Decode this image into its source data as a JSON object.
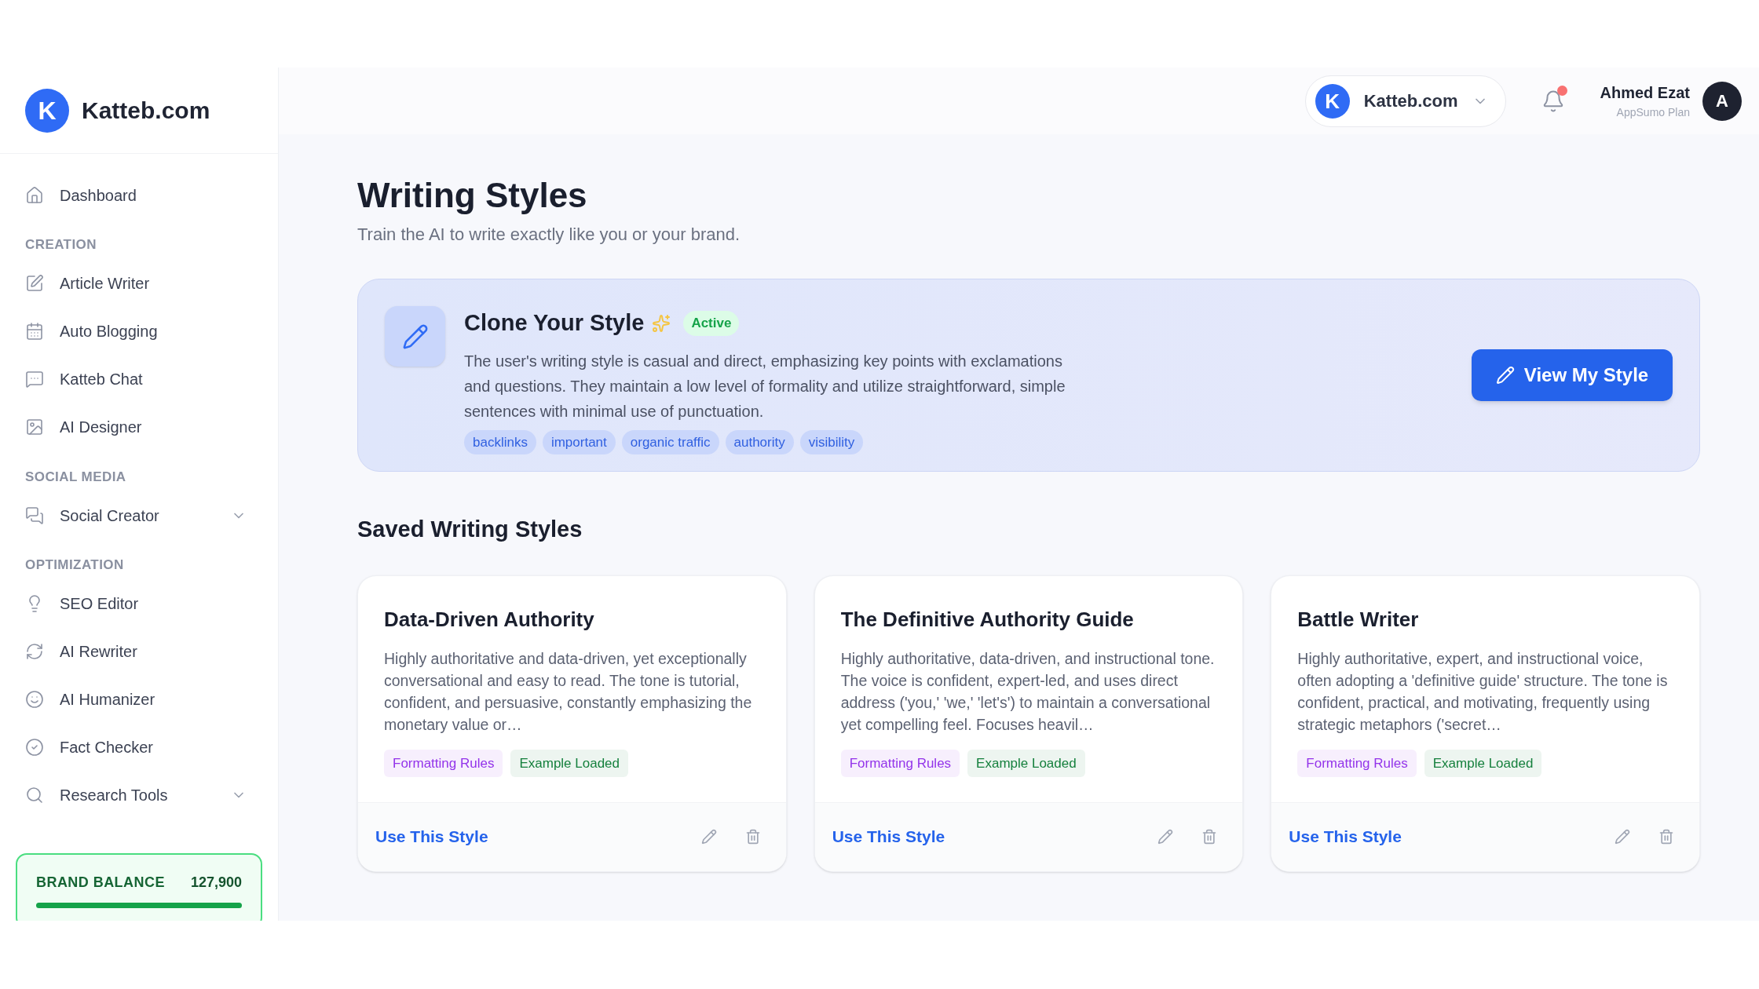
{
  "brand": {
    "name": "Katteb.com",
    "logo_letter": "K"
  },
  "sidebar": {
    "sections": [
      {
        "items": [
          {
            "label": "Dashboard",
            "kind": "link"
          }
        ]
      },
      {
        "heading": "CREATION",
        "items": [
          {
            "label": "Article Writer",
            "kind": "link"
          },
          {
            "label": "Auto Blogging",
            "kind": "link"
          },
          {
            "label": "Katteb Chat",
            "kind": "link"
          },
          {
            "label": "AI Designer",
            "kind": "link"
          }
        ]
      },
      {
        "heading": "SOCIAL MEDIA",
        "items": [
          {
            "label": "Social Creator",
            "kind": "group",
            "expanded": false
          }
        ]
      },
      {
        "heading": "OPTIMIZATION",
        "items": [
          {
            "label": "SEO Editor",
            "kind": "link"
          },
          {
            "label": "AI Rewriter",
            "kind": "link"
          },
          {
            "label": "AI Humanizer",
            "kind": "link"
          },
          {
            "label": "Fact Checker",
            "kind": "link"
          },
          {
            "label": "Research Tools",
            "kind": "group",
            "expanded": false
          }
        ]
      }
    ],
    "balance": {
      "label": "BRAND BALANCE",
      "value": "127,900",
      "level": 1.0
    }
  },
  "header": {
    "workspace": {
      "letter": "K",
      "name": "Katteb.com"
    },
    "notifications": {
      "unread": true
    },
    "user": {
      "name": "Ahmed Ezat",
      "plan": "AppSumo Plan",
      "initial": "A"
    }
  },
  "page": {
    "title": "Writing Styles",
    "subtitle": "Train the AI to write exactly like you or your brand."
  },
  "clone": {
    "title": "Clone Your Style",
    "badge": "Active",
    "description": "The user's writing style is casual and direct, emphasizing key points with exclamations and questions. They maintain a low level of formality and utilize straightforward, simple sentences with minimal use of punctuation.",
    "tags": [
      "backlinks",
      "important",
      "organic traffic",
      "authority",
      "visibility"
    ],
    "button": "View My Style"
  },
  "saved": {
    "heading": "Saved Writing Styles",
    "cards": [
      {
        "title": "Data-Driven Authority",
        "description": "Highly authoritative and data-driven, yet exceptionally conversational and easy to read. The tone is tutorial, confident, and persuasive, constantly emphasizing the monetary value or…",
        "tags": [
          {
            "label": "Formatting Rules",
            "color": "#9333ea"
          },
          {
            "label": "Example Loaded",
            "color": "#15803d"
          }
        ],
        "action": "Use This Style"
      },
      {
        "title": "The Definitive Authority Guide",
        "description": "Highly authoritative, data-driven, and instructional tone. The voice is confident, expert-led, and uses direct address ('you,' 'we,' 'let's') to maintain a conversational yet compelling feel. Focuses heavil…",
        "tags": [
          {
            "label": "Formatting Rules",
            "color": "#9333ea"
          },
          {
            "label": "Example Loaded",
            "color": "#15803d"
          }
        ],
        "action": "Use This Style"
      },
      {
        "title": "Battle Writer",
        "description": "Highly authoritative, expert, and instructional voice, often adopting a 'definitive guide' structure. The tone is confident, practical, and motivating, frequently using strategic metaphors ('secret…",
        "tags": [
          {
            "label": "Formatting Rules",
            "color": "#9333ea"
          },
          {
            "label": "Example Loaded",
            "color": "#15803d"
          }
        ],
        "action": "Use This Style"
      }
    ]
  }
}
